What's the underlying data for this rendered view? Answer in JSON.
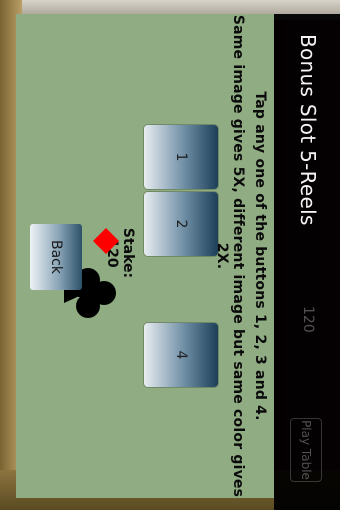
{
  "app": {
    "title": "Bonus Slot 5-Reels"
  },
  "header_ghost": {
    "stake": "120",
    "play_label": "Play Table"
  },
  "instructions": {
    "line1": "Tap any one of the buttons 1, 2, 3 and 4.",
    "line2": "Same image gives 5X, different image but same color gives 2X."
  },
  "buttons": [
    {
      "label": "1"
    },
    {
      "label": "2"
    },
    {
      "label": "4"
    }
  ],
  "stake_text": "Stake: 120",
  "back_label": "Back",
  "cards": [
    {
      "suit": "diamond",
      "color": "#ff0000"
    },
    {
      "suit": "club",
      "color": "#000000"
    }
  ]
}
